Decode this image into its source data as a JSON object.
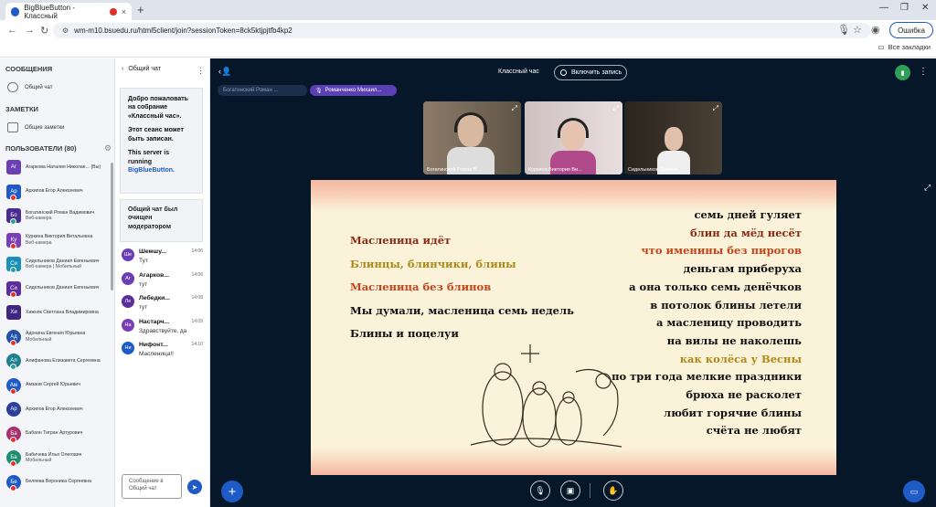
{
  "browser": {
    "tab_title": "BigBlueButton - Классный",
    "tab_close": "×",
    "new_tab": "+",
    "url": "wm-m10.bsuedu.ru/html5client/join?sessionToken=8ck5ktjpjtfb4kp2",
    "error_button": "Ошибка",
    "all_bookmarks": "Все закладки"
  },
  "sidebar": {
    "messages_title": "СООБЩЕНИЯ",
    "public_chat_item": "Общий чат",
    "notes_title": "ЗАМЕТКИ",
    "shared_notes_item": "Общие заметки",
    "users_title": "ПОЛЬЗОВАТЕЛИ (80)",
    "users": [
      {
        "initials": "Аг",
        "name": "Агаркова Наталия Николае... (Вы)",
        "sub": "",
        "color": "#6c3fb5",
        "round": false,
        "dot": ""
      },
      {
        "initials": "Ар",
        "name": "Архипов Егор Алексеевич",
        "sub": "",
        "color": "#1e5bc6",
        "round": false,
        "dot": "#e0322a"
      },
      {
        "initials": "Бо",
        "name": "Богатинский Роман Вадимович",
        "sub": "Веб-камера",
        "color": "#4a2d8f",
        "round": false,
        "dot": "#2aa198"
      },
      {
        "initials": "Ку",
        "name": "Куркина Виктория Витальевна",
        "sub": "Веб-камера",
        "color": "#7b3fb5",
        "round": false,
        "dot": "#e0322a"
      },
      {
        "initials": "Си",
        "name": "Сидельников Даниил Евгеньевич",
        "sub": "Веб-камера | Мобильный",
        "color": "#1b8fb8",
        "round": false,
        "dot": "#2aa198"
      },
      {
        "initials": "Си",
        "name": "Сидельников Даниил Евгеньевич",
        "sub": "",
        "color": "#5b2d9f",
        "round": false,
        "dot": "#e0322a"
      },
      {
        "initials": "Хи",
        "name": "Хижняк Светлана Владимировна",
        "sub": "",
        "color": "#3d2780",
        "round": false,
        "dot": ""
      },
      {
        "initials": "Ад",
        "name": "Адонина Евгения Юрьевна",
        "sub": "Мобильный",
        "color": "#2150a8",
        "round": true,
        "dot": "#e0322a"
      },
      {
        "initials": "Ал",
        "name": "Алифанова Елизавета Сергеевна",
        "sub": "",
        "color": "#1e7f8f",
        "round": true,
        "dot": "#2aa198"
      },
      {
        "initials": "Ам",
        "name": "Амзаов Сергей Юрьевич",
        "sub": "",
        "color": "#1e5bc6",
        "round": true,
        "dot": "#e0322a"
      },
      {
        "initials": "Ар",
        "name": "Архипов Егор Алексеевич",
        "sub": "",
        "color": "#2a3f9a",
        "round": true,
        "dot": ""
      },
      {
        "initials": "Ба",
        "name": "Бабаян Тигран Артурович",
        "sub": "",
        "color": "#a4326e",
        "round": true,
        "dot": "#e0322a"
      },
      {
        "initials": "Ба",
        "name": "Бабичева Илья Олегович",
        "sub": "Мобильный",
        "color": "#1b8f6f",
        "round": true,
        "dot": "#e0322a"
      },
      {
        "initials": "Бе",
        "name": "Беляева Вероника Сергеевна",
        "sub": "",
        "color": "#1e5bc6",
        "round": true,
        "dot": "#e0322a"
      }
    ]
  },
  "chat": {
    "title": "Общий чат",
    "welcome_1": "Добро пожаловать на собрание «Классный час».",
    "welcome_2": "Этот сеанс может быть записан.",
    "welcome_3": "This server is running",
    "welcome_link": "BigBlueButton.",
    "cleared": "Общий чат был очищен модератором",
    "messages": [
      {
        "initials": "Ше",
        "name": "Шемшу...",
        "time": "14:06",
        "text": "Тут",
        "color": "#6c3fb5"
      },
      {
        "initials": "Аг",
        "name": "Агарков...",
        "time": "14:06",
        "text": "тут",
        "color": "#6c3fb5"
      },
      {
        "initials": "Ле",
        "name": "Лебедки...",
        "time": "14:08",
        "text": "тут",
        "color": "#5b2d9f"
      },
      {
        "initials": "На",
        "name": "Настарч...",
        "time": "14:09",
        "text": "Здравствуйте, да",
        "color": "#7b3fb5"
      },
      {
        "initials": "Ни",
        "name": "Нифонт...",
        "time": "14:10",
        "text": "Масленица!!",
        "color": "#1e5bc6"
      }
    ],
    "input_placeholder": "Сообщение в Общий чат"
  },
  "meeting": {
    "title": "Классный час",
    "record_button": "Включить запись",
    "talkers": [
      {
        "name": "Богатинский Роман ...",
        "active": false
      },
      {
        "name": "Романченко Михаил...",
        "active": true
      }
    ],
    "cameras": [
      {
        "caption": "Богатинский Роман В...",
        "bg": "#7a6a5a"
      },
      {
        "caption": "Куркина Виктория Ви...",
        "bg": "#d8c9c9"
      },
      {
        "caption": "Сидельников Даниил...",
        "bg": "#3a3228"
      }
    ]
  },
  "slide": {
    "left_lines": [
      {
        "text": "Масленица идёт",
        "color": "#8a2a12"
      },
      {
        "text": "Блинцы, блинчики, блины",
        "color": "#b08a14"
      },
      {
        "text": "Масленица без блинов",
        "color": "#c0461c"
      },
      {
        "text": "Мы думали, масленица семь недель",
        "color": "#111111"
      },
      {
        "text": "Блины и поцелуи",
        "color": "#111111"
      }
    ],
    "right_lines": [
      {
        "text": "семь дней гуляет",
        "color": "#111111"
      },
      {
        "text": "блин да мёд несёт",
        "color": "#8a2a12"
      },
      {
        "text": "что именины без пирогов",
        "color": "#c0461c"
      },
      {
        "text": "деньгам приберуха",
        "color": "#111111"
      },
      {
        "text": "а она только семь денёчков",
        "color": "#111111"
      },
      {
        "text": "в потолок блины летели",
        "color": "#111111"
      },
      {
        "text": "а масленицу проводить",
        "color": "#111111"
      },
      {
        "text": "на вилы не наколешь",
        "color": "#111111"
      },
      {
        "text": "как колёса у Весны",
        "color": "#b08a14"
      },
      {
        "text": "по три года мелкие праздники",
        "color": "#111111"
      },
      {
        "text": "брюха не расколет",
        "color": "#111111"
      },
      {
        "text": "любит горячие блины",
        "color": "#111111"
      },
      {
        "text": "счёта не любят",
        "color": "#111111"
      }
    ]
  }
}
